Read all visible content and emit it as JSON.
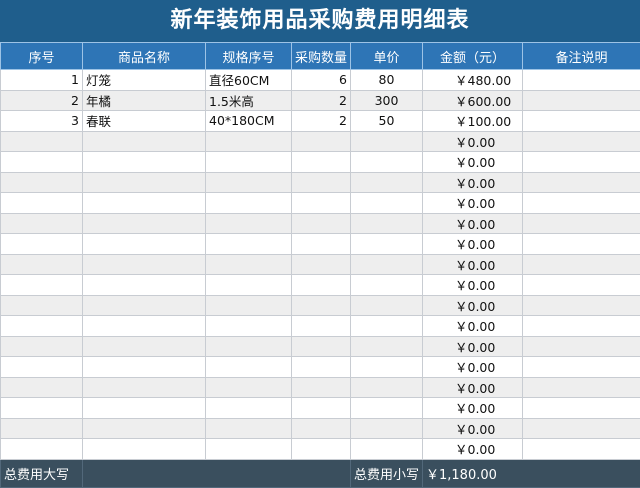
{
  "title": "新年装饰用品采购费用明细表",
  "headers": [
    "序号",
    "商品名称",
    "规格序号",
    "采购数量",
    "单价",
    "金额（元）",
    "备注说明"
  ],
  "rows": [
    {
      "no": "1",
      "name": "灯笼",
      "spec": "直径60CM",
      "qty": "6",
      "price": "80",
      "amount": "￥480.00",
      "note": ""
    },
    {
      "no": "2",
      "name": "年橘",
      "spec": "1.5米高",
      "qty": "2",
      "price": "300",
      "amount": "￥600.00",
      "note": ""
    },
    {
      "no": "3",
      "name": "春联",
      "spec": "40*180CM",
      "qty": "2",
      "price": "50",
      "amount": "￥100.00",
      "note": ""
    },
    {
      "no": "",
      "name": "",
      "spec": "",
      "qty": "",
      "price": "",
      "amount": "￥0.00",
      "note": ""
    },
    {
      "no": "",
      "name": "",
      "spec": "",
      "qty": "",
      "price": "",
      "amount": "￥0.00",
      "note": ""
    },
    {
      "no": "",
      "name": "",
      "spec": "",
      "qty": "",
      "price": "",
      "amount": "￥0.00",
      "note": ""
    },
    {
      "no": "",
      "name": "",
      "spec": "",
      "qty": "",
      "price": "",
      "amount": "￥0.00",
      "note": ""
    },
    {
      "no": "",
      "name": "",
      "spec": "",
      "qty": "",
      "price": "",
      "amount": "￥0.00",
      "note": ""
    },
    {
      "no": "",
      "name": "",
      "spec": "",
      "qty": "",
      "price": "",
      "amount": "￥0.00",
      "note": ""
    },
    {
      "no": "",
      "name": "",
      "spec": "",
      "qty": "",
      "price": "",
      "amount": "￥0.00",
      "note": ""
    },
    {
      "no": "",
      "name": "",
      "spec": "",
      "qty": "",
      "price": "",
      "amount": "￥0.00",
      "note": ""
    },
    {
      "no": "",
      "name": "",
      "spec": "",
      "qty": "",
      "price": "",
      "amount": "￥0.00",
      "note": ""
    },
    {
      "no": "",
      "name": "",
      "spec": "",
      "qty": "",
      "price": "",
      "amount": "￥0.00",
      "note": ""
    },
    {
      "no": "",
      "name": "",
      "spec": "",
      "qty": "",
      "price": "",
      "amount": "￥0.00",
      "note": ""
    },
    {
      "no": "",
      "name": "",
      "spec": "",
      "qty": "",
      "price": "",
      "amount": "￥0.00",
      "note": ""
    },
    {
      "no": "",
      "name": "",
      "spec": "",
      "qty": "",
      "price": "",
      "amount": "￥0.00",
      "note": ""
    },
    {
      "no": "",
      "name": "",
      "spec": "",
      "qty": "",
      "price": "",
      "amount": "￥0.00",
      "note": ""
    },
    {
      "no": "",
      "name": "",
      "spec": "",
      "qty": "",
      "price": "",
      "amount": "￥0.00",
      "note": ""
    },
    {
      "no": "",
      "name": "",
      "spec": "",
      "qty": "",
      "price": "",
      "amount": "￥0.00",
      "note": ""
    }
  ],
  "footer": {
    "total_upper_label": "总费用大写",
    "total_upper_value": "",
    "total_lower_label": "总费用小写",
    "total_lower_value": "￥1,180.00"
  },
  "colors": {
    "title_bg": "#1f5e8c",
    "header_bg": "#2e75b6",
    "footer_bg": "#3a4f5e",
    "stripe": "#eeeeee"
  }
}
